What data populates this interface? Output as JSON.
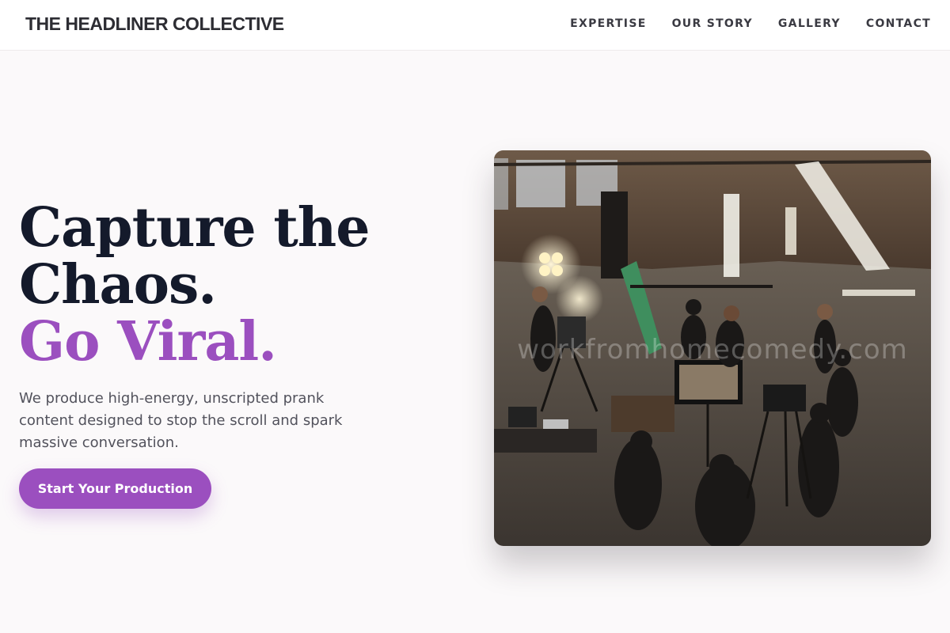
{
  "header": {
    "brand": "THE HEADLINER COLLECTIVE",
    "nav": [
      "EXPERTISE",
      "OUR STORY",
      "GALLERY",
      "CONTACT"
    ]
  },
  "hero": {
    "headline_line1": "Capture the",
    "headline_line2": "Chaos.",
    "headline_accent": "Go Viral.",
    "description": "We produce high-energy, unscripted prank content designed to stop the scroll and spark massive conversation.",
    "cta_label": "Start Your Production",
    "image_watermark": "workfromhomecomedy.com"
  },
  "colors": {
    "accent": "#9b4fbf",
    "heading": "#141a2b",
    "body_text": "#52525c",
    "background": "#fbf9fa"
  }
}
